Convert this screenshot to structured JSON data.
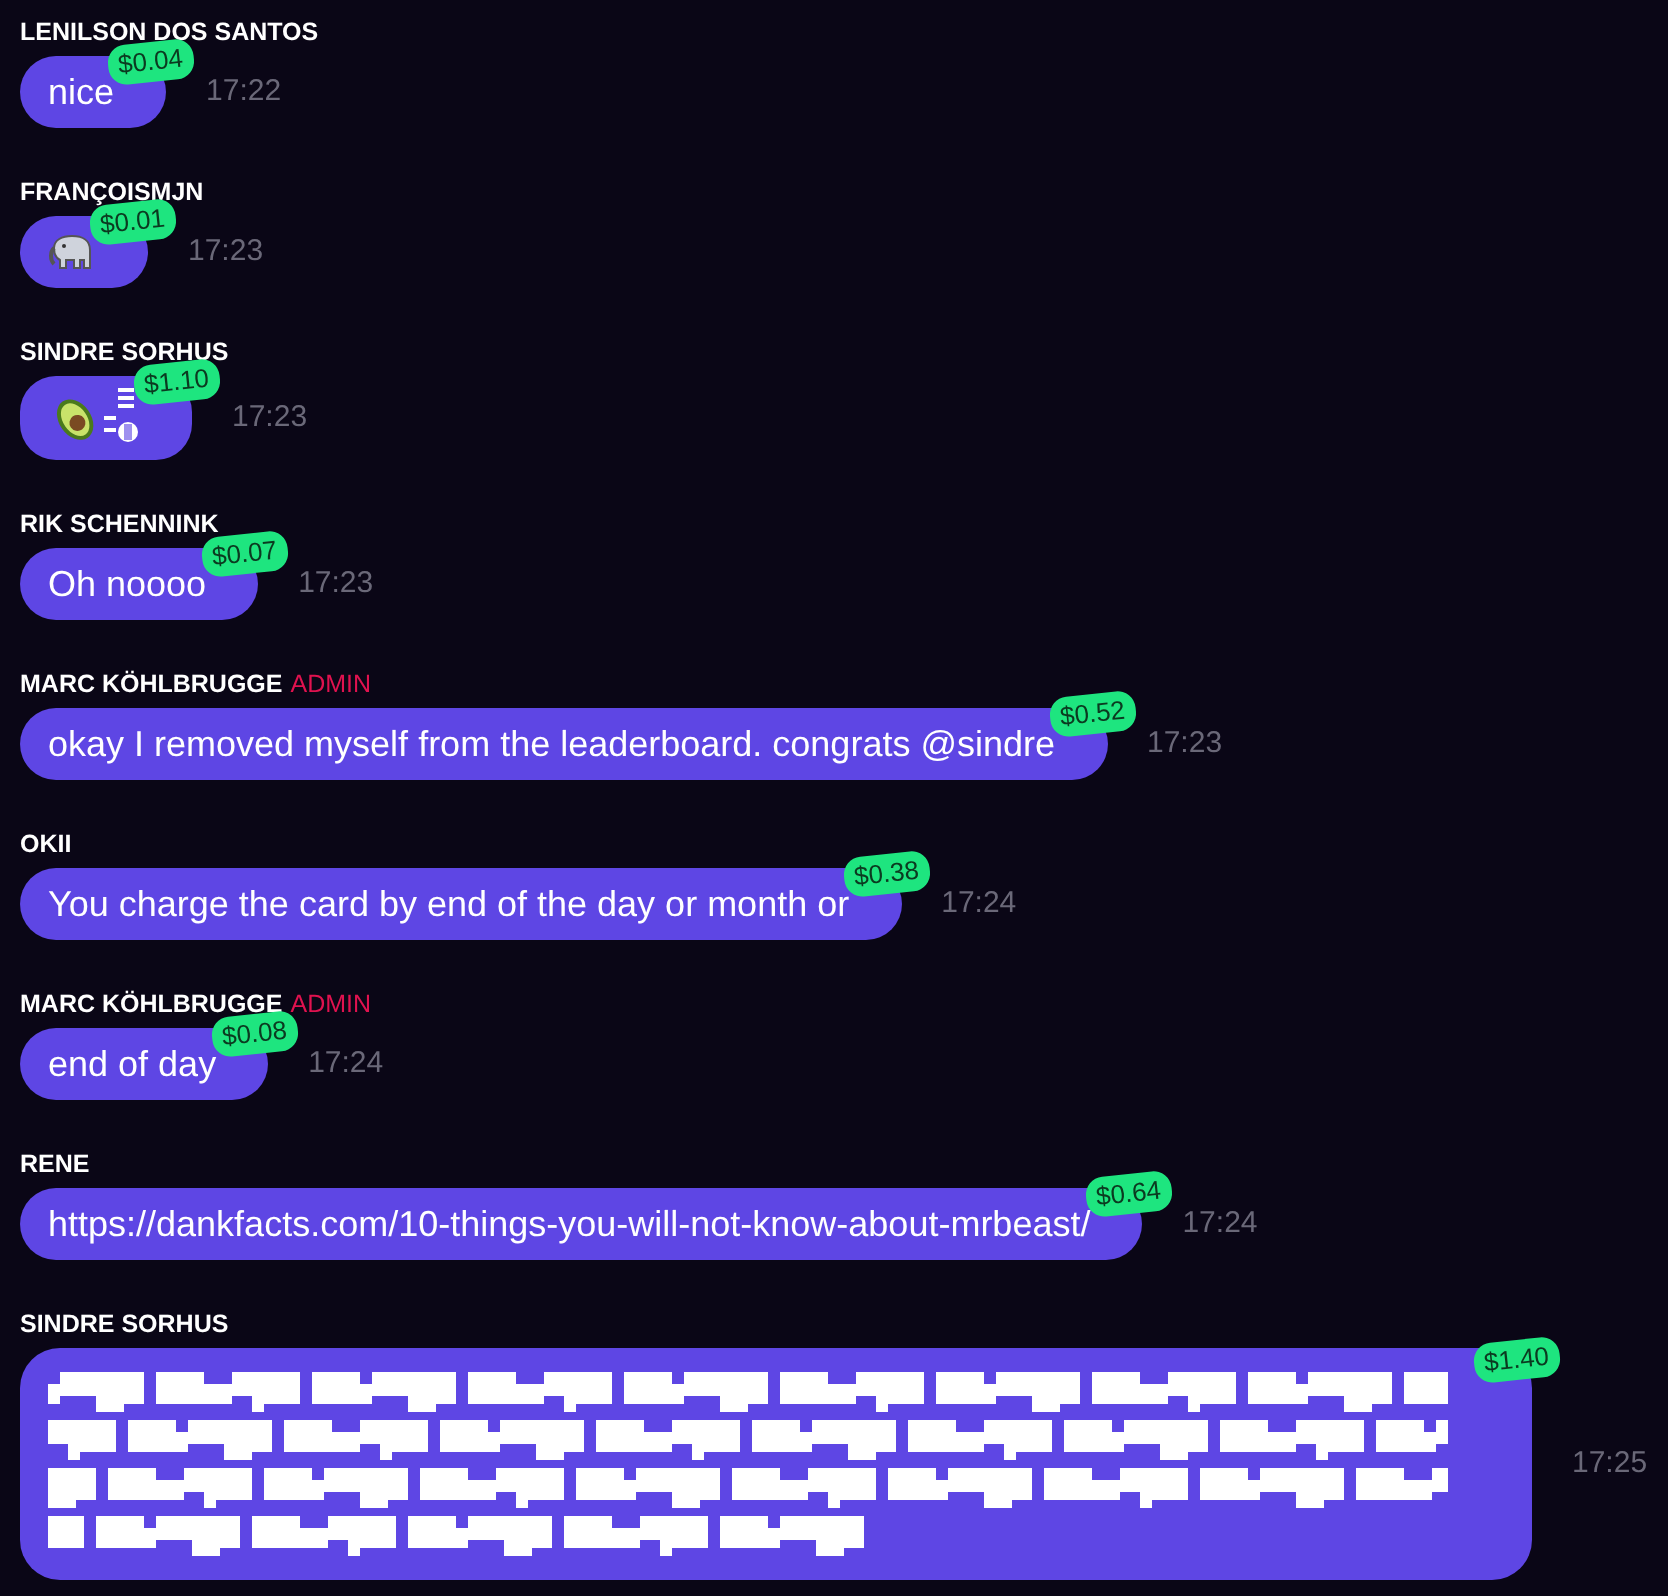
{
  "messages": [
    {
      "author": "LENILSON DOS SANTOS",
      "kind": "text",
      "text": "nice",
      "tip": "$0.04",
      "time": "17:22"
    },
    {
      "author": "FRANÇOISMJN",
      "kind": "elephant",
      "tip": "$0.01",
      "time": "17:23"
    },
    {
      "author": "SINDRE SORHUS",
      "kind": "avocado",
      "tip": "$1.10",
      "time": "17:23"
    },
    {
      "author": "RIK SCHENNINK",
      "kind": "text",
      "text": "Oh noooo",
      "tip": "$0.07",
      "time": "17:23"
    },
    {
      "author": "MARC KÖHLBRUGGE",
      "role": "ADMIN",
      "kind": "text",
      "text": "okay I removed myself from the leaderboard. congrats @sindre",
      "tip": "$0.52",
      "time": "17:23"
    },
    {
      "author": "OKII",
      "kind": "text",
      "text": "You charge the card by end of the day or month or",
      "tip": "$0.38",
      "time": "17:24"
    },
    {
      "author": "MARC KÖHLBRUGGE",
      "role": "ADMIN",
      "kind": "text",
      "text": "end of day",
      "tip": "$0.08",
      "time": "17:24"
    },
    {
      "author": "RENE",
      "kind": "text",
      "text": "https://dankfacts.com/10-things-you-will-not-know-about-mrbeast/",
      "tip": "$0.64",
      "time": "17:24"
    },
    {
      "author": "SINDRE SORHUS",
      "kind": "art",
      "tip": "$1.40",
      "time": "17:25"
    }
  ]
}
